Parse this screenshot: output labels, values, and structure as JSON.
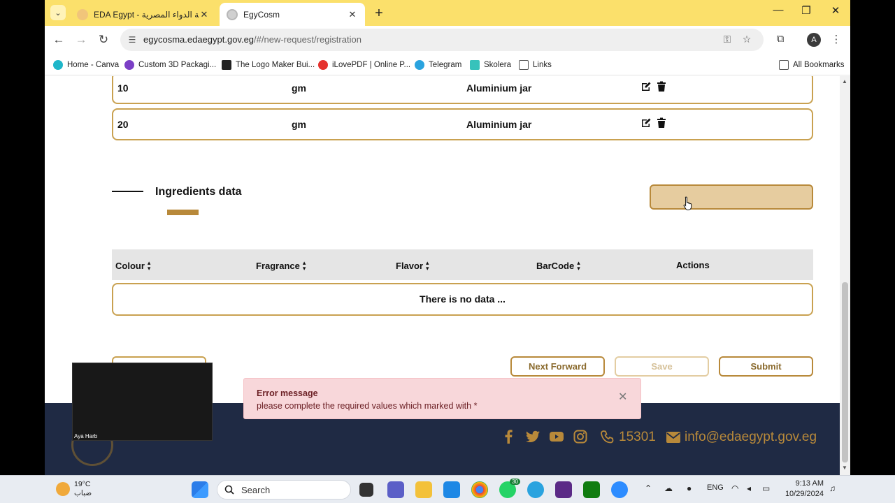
{
  "browser": {
    "tabs": [
      {
        "title": "EDA Egypt - هيئة الدواء المصرية",
        "active": false
      },
      {
        "title": "EgyCosm",
        "active": true
      }
    ],
    "url_host": "egycosma.edaegypt.gov.eg",
    "url_path": "/#/new-request/registration",
    "profile_initial": "A",
    "bookmarks": [
      "Home - Canva",
      "Custom 3D Packagi...",
      "The Logo Maker Bui...",
      "iLovePDF | Online P...",
      "Telegram",
      "Skolera",
      "Links"
    ],
    "all_bookmarks": "All Bookmarks"
  },
  "packaging_rows": [
    {
      "volume": "10",
      "unit": "gm",
      "container": "Aluminium jar"
    },
    {
      "volume": "20",
      "unit": "gm",
      "container": "Aluminium jar"
    }
  ],
  "ingredients": {
    "title": "Ingredients data",
    "columns": [
      "Colour",
      "Fragrance",
      "Flavor",
      "BarCode",
      "Actions"
    ],
    "empty_text": "There is no data ..."
  },
  "buttons": {
    "next_forward": "Next Forward",
    "save": "Save",
    "submit": "Submit"
  },
  "toast": {
    "title": "Error message",
    "message": "please complete the required values which marked with *"
  },
  "video": {
    "participant": "Aya Harb"
  },
  "footer": {
    "phone": "15301",
    "email": "info@edaegypt.gov.eg"
  },
  "taskbar": {
    "temperature": "19°C",
    "weather": "ضباب",
    "search_placeholder": "Search",
    "language": "ENG",
    "time": "9:13 AM",
    "date": "10/29/2024",
    "whatsapp_badge": "30"
  }
}
